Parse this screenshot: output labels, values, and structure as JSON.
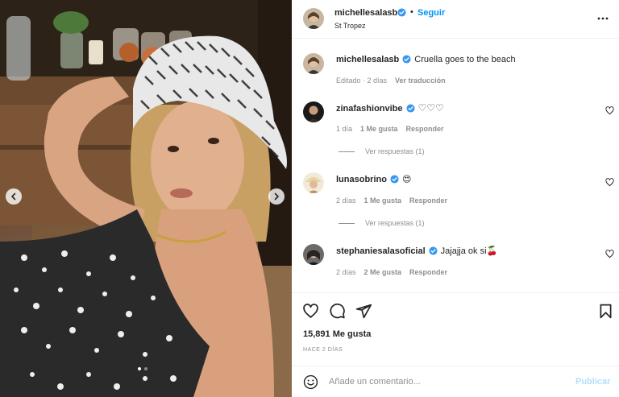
{
  "post": {
    "image_alt": "",
    "carousel": {
      "total": 2,
      "current": 1
    }
  },
  "header": {
    "username": "michellesalasb",
    "separator": "•",
    "follow_label": "Seguir",
    "location": "St Tropez"
  },
  "caption": {
    "username": "michellesalasb",
    "text": "Cruella goes to the beach",
    "meta_edited": "Editado · 2 días",
    "see_translation": "Ver traducción"
  },
  "comments": [
    {
      "username": "zinafashionvibe",
      "text": "♡♡♡",
      "time": "1 día",
      "likes": "1 Me gusta",
      "reply": "Responder",
      "view_replies": "Ver respuestas (1)"
    },
    {
      "username": "lunasobrino",
      "text": "😍",
      "time": "2 días",
      "likes": "1 Me gusta",
      "reply": "Responder",
      "view_replies": "Ver respuestas (1)"
    },
    {
      "username": "stephaniesalasoficial",
      "text": "Jajajja ok si🍒",
      "time": "2 días",
      "likes": "2 Me gusta",
      "reply": "Responder"
    }
  ],
  "actions": {
    "likes_count": "15,891 Me gusta",
    "time_ago": "HACE 2 DÍAS"
  },
  "compose": {
    "placeholder": "Añade un comentario...",
    "publish_label": "Publicar"
  },
  "colors": {
    "accent": "#0095f6",
    "verified": "#3897f0",
    "publish_disabled": "#b2dffc",
    "muted": "#8e8e8e"
  }
}
